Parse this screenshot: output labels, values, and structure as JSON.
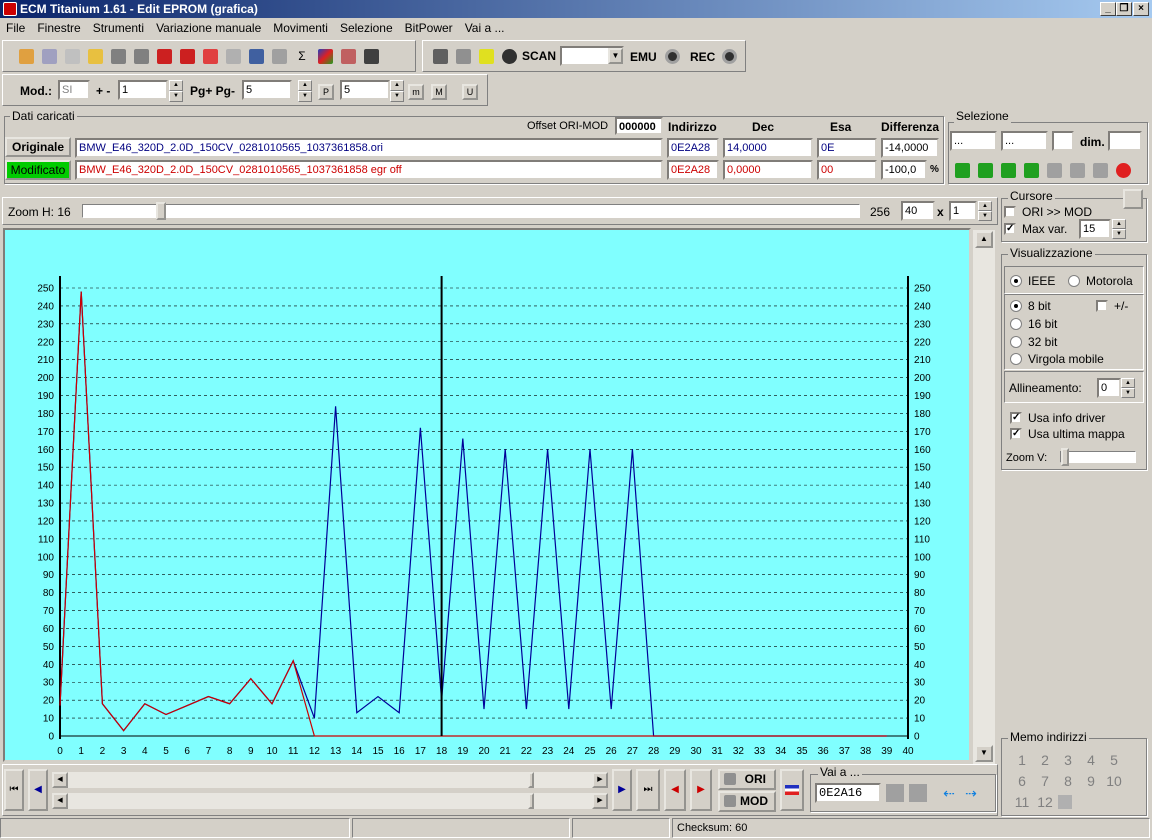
{
  "window": {
    "title": "ECM Titanium 1.61 - Edit EPROM (grafica)"
  },
  "menu": [
    "File",
    "Finestre",
    "Strumenti",
    "Variazione manuale",
    "Movimenti",
    "Selezione",
    "BitPower",
    "Vai a ..."
  ],
  "toolbar": {
    "scan_label": "SCAN",
    "scan_value": "",
    "emu_label": "EMU",
    "rec_label": "REC"
  },
  "toolbar2": {
    "mod_label": "Mod.:",
    "mod_value": "SI",
    "pm_label": "+ -",
    "pm_value": "1",
    "pg_label": "Pg+ Pg-",
    "pg_value": "5",
    "p_value": "5",
    "btn_p": "P",
    "btn_m": "m",
    "btn_M": "M",
    "btn_U": "U"
  },
  "dati": {
    "title": "Dati caricati",
    "offset_label": "Offset ORI-MOD",
    "offset_value": "000000",
    "headers": {
      "indirizzo": "Indirizzo",
      "dec": "Dec",
      "esa": "Esa",
      "differenza": "Differenza"
    },
    "originale": {
      "button": "Originale",
      "file": "BMW_E46_320D_2.0D_150CV_0281010565_1037361858.ori",
      "indirizzo": "0E2A28",
      "dec": "14,0000",
      "esa": "0E",
      "differenza": "-14,0000"
    },
    "modificato": {
      "button": "Modificato",
      "file": "BMW_E46_320D_2.0D_150CV_0281010565_1037361858 egr off",
      "indirizzo": "0E2A28",
      "dec": "0,0000",
      "esa": "00",
      "differenza": "-100,0",
      "pct": "%"
    }
  },
  "selezione": {
    "title": "Selezione",
    "f1": "...",
    "f2": "...",
    "f3": "",
    "dim_label": "dim.",
    "dim_value": ""
  },
  "zoom": {
    "label": "Zoom H: 16",
    "max": "256",
    "value": "40",
    "x_label": "x",
    "mult": "1"
  },
  "cursore": {
    "title": "Cursore",
    "ori_mod": "ORI >> MOD",
    "max_var": "Max var.",
    "max_var_value": "15"
  },
  "visualizzazione": {
    "title": "Visualizzazione",
    "ieee": "IEEE",
    "motorola": "Motorola",
    "bit8": "8 bit",
    "pm": "+/-",
    "bit16": "16 bit",
    "bit32": "32 bit",
    "virgola": "Virgola mobile",
    "allineamento": "Allineamento:",
    "allineamento_value": "0",
    "usa_info": "Usa info driver",
    "usa_mappa": "Usa ultima mappa",
    "zoom_v": "Zoom V:"
  },
  "memo": {
    "title": "Memo indirizzi",
    "numbers": [
      "1",
      "2",
      "3",
      "4",
      "5",
      "6",
      "7",
      "8",
      "9",
      "10",
      "11",
      "12"
    ]
  },
  "bottom": {
    "ori": "ORI",
    "mod": "MOD",
    "vai_label": "Vai a ...",
    "vai_value": "0E2A16"
  },
  "status": {
    "checksum": "Checksum: 60"
  },
  "colors": {
    "plot_bg": "#80ffff",
    "ori": "#cc0000",
    "mod": "#000099",
    "dec_highlight": "#00cc00"
  },
  "chart_data": {
    "type": "line",
    "x": [
      0,
      1,
      2,
      3,
      4,
      5,
      6,
      7,
      8,
      9,
      10,
      11,
      12,
      13,
      14,
      15,
      16,
      17,
      18,
      19,
      20,
      21,
      22,
      23,
      24,
      25,
      26,
      27,
      28,
      29,
      30,
      31,
      32,
      33,
      34,
      35,
      36,
      37,
      38,
      39,
      40
    ],
    "xlim": [
      0,
      40
    ],
    "ylim": [
      0,
      250
    ],
    "y_ticks": [
      0,
      10,
      20,
      30,
      40,
      50,
      60,
      70,
      80,
      90,
      100,
      110,
      120,
      130,
      140,
      150,
      160,
      170,
      180,
      190,
      200,
      210,
      220,
      230,
      240,
      250
    ],
    "cursor_x": 18,
    "series": [
      {
        "values": [
          17,
          248,
          18,
          3,
          18,
          12,
          17,
          22,
          18,
          32,
          18,
          42,
          10,
          184,
          13,
          22,
          13,
          172,
          20,
          166,
          15,
          160,
          15,
          160,
          15,
          160,
          15,
          160,
          0,
          0,
          0,
          0,
          0,
          0,
          0,
          0,
          0,
          0,
          0,
          0
        ]
      },
      {
        "values": [
          17,
          248,
          18,
          3,
          18,
          12,
          17,
          22,
          18,
          32,
          18,
          42,
          0,
          0,
          0,
          0,
          0,
          0,
          0,
          0,
          0,
          0,
          0,
          0,
          0,
          0,
          0,
          0,
          0,
          0,
          0,
          0,
          0,
          0,
          0,
          0,
          0,
          0,
          0,
          0
        ]
      }
    ],
    "grid": true
  }
}
